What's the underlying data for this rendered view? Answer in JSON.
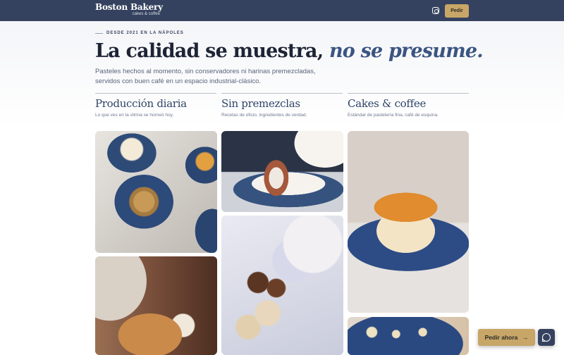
{
  "header": {
    "brand_name": "Boston Bakery",
    "brand_sub": "cakes & coffee",
    "instagram_icon": "instagram-icon",
    "order_label": "Pedir"
  },
  "hero": {
    "eyebrow": "DESDE 2021 EN LA NÁPOLES",
    "headline_main": "La calidad se muestra, ",
    "headline_accent": "no se presume.",
    "lede": "Pasteles hechos al momento, sin conservadores ni harinas premezcladas, servidos con buen café en un espacio industrial-clásico."
  },
  "features": [
    {
      "title": "Producción diaria",
      "desc": "Lo que ves en la vitrina se horneó hoy."
    },
    {
      "title": "Sin premezclas",
      "desc": "Recetas de oficio, ingredientes de verdad."
    },
    {
      "title": "Cakes & coffee",
      "desc": "Estándar de pastelería fina, café de esquina."
    }
  ],
  "floating": {
    "order_label": "Pedir ahora",
    "arrow": "→",
    "chat_icon": "whatsapp-icon"
  },
  "colors": {
    "nav_bg": "#35425f",
    "accent_gold": "#c8a667",
    "headline_accent": "#3b5582"
  }
}
